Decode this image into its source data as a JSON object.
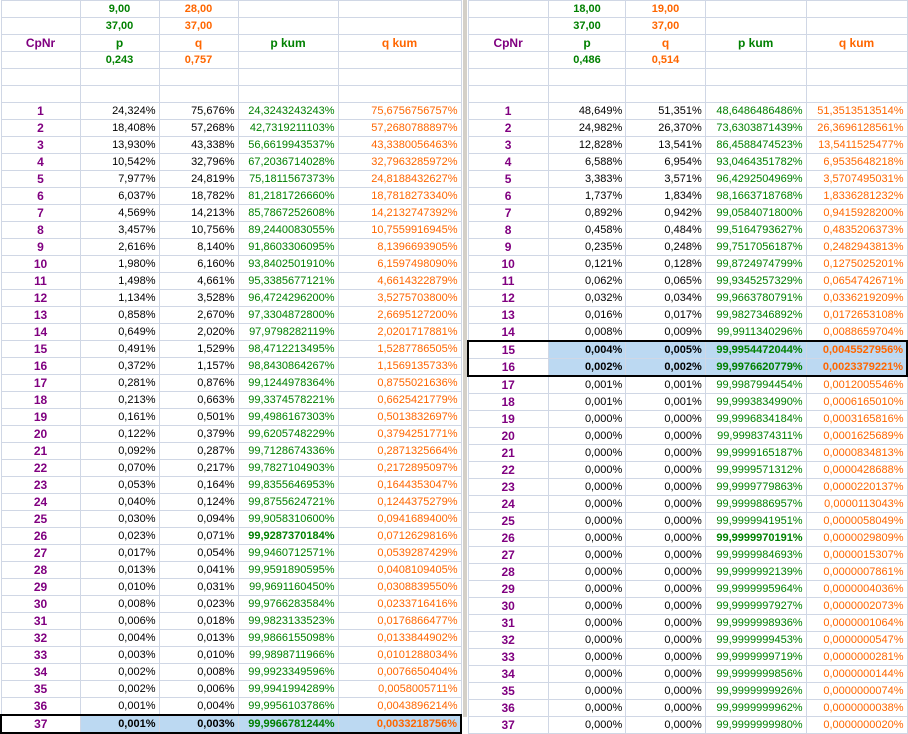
{
  "left": {
    "top1": {
      "p": "9,00",
      "q": "28,00"
    },
    "top2": {
      "p": "37,00",
      "q": "37,00"
    },
    "headers": {
      "nr": "CpNr",
      "p": "p",
      "q": "q",
      "pk": "p kum",
      "qk": "q kum"
    },
    "probs": {
      "p": "0,243",
      "q": "0,757"
    },
    "rows": [
      [
        "1",
        "24,324%",
        "75,676%",
        "24,3243243243%",
        "75,6756756757%"
      ],
      [
        "2",
        "18,408%",
        "57,268%",
        "42,7319211103%",
        "57,2680788897%"
      ],
      [
        "3",
        "13,930%",
        "43,338%",
        "56,6619943537%",
        "43,3380056463%"
      ],
      [
        "4",
        "10,542%",
        "32,796%",
        "67,2036714028%",
        "32,7963285972%"
      ],
      [
        "5",
        "7,977%",
        "24,819%",
        "75,1811567373%",
        "24,8188432627%"
      ],
      [
        "6",
        "6,037%",
        "18,782%",
        "81,2181726660%",
        "18,7818273340%"
      ],
      [
        "7",
        "4,569%",
        "14,213%",
        "85,7867252608%",
        "14,2132747392%"
      ],
      [
        "8",
        "3,457%",
        "10,756%",
        "89,2440083055%",
        "10,7559916945%"
      ],
      [
        "9",
        "2,616%",
        "8,140%",
        "91,8603306095%",
        "8,1396693905%"
      ],
      [
        "10",
        "1,980%",
        "6,160%",
        "93,8402501910%",
        "6,1597498090%"
      ],
      [
        "11",
        "1,498%",
        "4,661%",
        "95,3385677121%",
        "4,6614322879%"
      ],
      [
        "12",
        "1,134%",
        "3,528%",
        "96,4724296200%",
        "3,5275703800%"
      ],
      [
        "13",
        "0,858%",
        "2,670%",
        "97,3304872800%",
        "2,6695127200%"
      ],
      [
        "14",
        "0,649%",
        "2,020%",
        "97,9798282119%",
        "2,0201717881%"
      ],
      [
        "15",
        "0,491%",
        "1,529%",
        "98,4712213495%",
        "1,5287786505%"
      ],
      [
        "16",
        "0,372%",
        "1,157%",
        "98,8430864267%",
        "1,1569135733%"
      ],
      [
        "17",
        "0,281%",
        "0,876%",
        "99,1244978364%",
        "0,8755021636%"
      ],
      [
        "18",
        "0,213%",
        "0,663%",
        "99,3374578221%",
        "0,6625421779%"
      ],
      [
        "19",
        "0,161%",
        "0,501%",
        "99,4986167303%",
        "0,5013832697%"
      ],
      [
        "20",
        "0,122%",
        "0,379%",
        "99,6205748229%",
        "0,3794251771%"
      ],
      [
        "21",
        "0,092%",
        "0,287%",
        "99,7128674336%",
        "0,2871325664%"
      ],
      [
        "22",
        "0,070%",
        "0,217%",
        "99,7827104903%",
        "0,2172895097%"
      ],
      [
        "23",
        "0,053%",
        "0,164%",
        "99,8355646953%",
        "0,1644353047%"
      ],
      [
        "24",
        "0,040%",
        "0,124%",
        "99,8755624721%",
        "0,1244375279%"
      ],
      [
        "25",
        "0,030%",
        "0,094%",
        "99,9058310600%",
        "0,0941689400%"
      ],
      [
        "26",
        "0,023%",
        "0,071%",
        "99,9287370184%",
        "0,0712629816%"
      ],
      [
        "27",
        "0,017%",
        "0,054%",
        "99,9460712571%",
        "0,0539287429%"
      ],
      [
        "28",
        "0,013%",
        "0,041%",
        "99,9591890595%",
        "0,0408109405%"
      ],
      [
        "29",
        "0,010%",
        "0,031%",
        "99,9691160450%",
        "0,0308839550%"
      ],
      [
        "30",
        "0,008%",
        "0,023%",
        "99,9766283584%",
        "0,0233716416%"
      ],
      [
        "31",
        "0,006%",
        "0,018%",
        "99,9823133523%",
        "0,0176866477%"
      ],
      [
        "32",
        "0,004%",
        "0,013%",
        "99,9866155098%",
        "0,0133844902%"
      ],
      [
        "33",
        "0,003%",
        "0,010%",
        "99,9898711966%",
        "0,0101288034%"
      ],
      [
        "34",
        "0,002%",
        "0,008%",
        "99,9923349596%",
        "0,0076650404%"
      ],
      [
        "35",
        "0,002%",
        "0,006%",
        "99,9941994289%",
        "0,0058005711%"
      ],
      [
        "36",
        "0,001%",
        "0,004%",
        "99,9956103786%",
        "0,0043896214%"
      ],
      [
        "37",
        "0,001%",
        "0,003%",
        "99,9966781244%",
        "0,0033218756%"
      ]
    ]
  },
  "right": {
    "top1": {
      "p": "18,00",
      "q": "19,00"
    },
    "top2": {
      "p": "37,00",
      "q": "37,00"
    },
    "headers": {
      "nr": "CpNr",
      "p": "p",
      "q": "q",
      "pk": "p kum",
      "qk": "q kum"
    },
    "probs": {
      "p": "0,486",
      "q": "0,514"
    },
    "rows": [
      [
        "1",
        "48,649%",
        "51,351%",
        "48,6486486486%",
        "51,3513513514%"
      ],
      [
        "2",
        "24,982%",
        "26,370%",
        "73,6303871439%",
        "26,3696128561%"
      ],
      [
        "3",
        "12,828%",
        "13,541%",
        "86,4588474523%",
        "13,5411525477%"
      ],
      [
        "4",
        "6,588%",
        "6,954%",
        "93,0464351782%",
        "6,9535648218%"
      ],
      [
        "5",
        "3,383%",
        "3,571%",
        "96,4292504969%",
        "3,5707495031%"
      ],
      [
        "6",
        "1,737%",
        "1,834%",
        "98,1663718768%",
        "1,8336281232%"
      ],
      [
        "7",
        "0,892%",
        "0,942%",
        "99,0584071800%",
        "0,9415928200%"
      ],
      [
        "8",
        "0,458%",
        "0,484%",
        "99,5164793627%",
        "0,4835206373%"
      ],
      [
        "9",
        "0,235%",
        "0,248%",
        "99,7517056187%",
        "0,2482943813%"
      ],
      [
        "10",
        "0,121%",
        "0,128%",
        "99,8724974799%",
        "0,1275025201%"
      ],
      [
        "11",
        "0,062%",
        "0,065%",
        "99,9345257329%",
        "0,0654742671%"
      ],
      [
        "12",
        "0,032%",
        "0,034%",
        "99,9663780791%",
        "0,0336219209%"
      ],
      [
        "13",
        "0,016%",
        "0,017%",
        "99,9827346892%",
        "0,0172653108%"
      ],
      [
        "14",
        "0,008%",
        "0,009%",
        "99,9911340296%",
        "0,0088659704%"
      ],
      [
        "15",
        "0,004%",
        "0,005%",
        "99,9954472044%",
        "0,0045527956%"
      ],
      [
        "16",
        "0,002%",
        "0,002%",
        "99,9976620779%",
        "0,0023379221%"
      ],
      [
        "17",
        "0,001%",
        "0,001%",
        "99,9987994454%",
        "0,0012005546%"
      ],
      [
        "18",
        "0,001%",
        "0,001%",
        "99,9993834990%",
        "0,0006165010%"
      ],
      [
        "19",
        "0,000%",
        "0,000%",
        "99,9996834184%",
        "0,0003165816%"
      ],
      [
        "20",
        "0,000%",
        "0,000%",
        "99,9998374311%",
        "0,0001625689%"
      ],
      [
        "21",
        "0,000%",
        "0,000%",
        "99,9999165187%",
        "0,0000834813%"
      ],
      [
        "22",
        "0,000%",
        "0,000%",
        "99,9999571312%",
        "0,0000428688%"
      ],
      [
        "23",
        "0,000%",
        "0,000%",
        "99,9999779863%",
        "0,0000220137%"
      ],
      [
        "24",
        "0,000%",
        "0,000%",
        "99,9999886957%",
        "0,0000113043%"
      ],
      [
        "25",
        "0,000%",
        "0,000%",
        "99,9999941951%",
        "0,0000058049%"
      ],
      [
        "26",
        "0,000%",
        "0,000%",
        "99,9999970191%",
        "0,0000029809%"
      ],
      [
        "27",
        "0,000%",
        "0,000%",
        "99,9999984693%",
        "0,0000015307%"
      ],
      [
        "28",
        "0,000%",
        "0,000%",
        "99,9999992139%",
        "0,0000007861%"
      ],
      [
        "29",
        "0,000%",
        "0,000%",
        "99,9999995964%",
        "0,0000004036%"
      ],
      [
        "30",
        "0,000%",
        "0,000%",
        "99,9999997927%",
        "0,0000002073%"
      ],
      [
        "31",
        "0,000%",
        "0,000%",
        "99,9999998936%",
        "0,0000001064%"
      ],
      [
        "32",
        "0,000%",
        "0,000%",
        "99,9999999453%",
        "0,0000000547%"
      ],
      [
        "33",
        "0,000%",
        "0,000%",
        "99,9999999719%",
        "0,0000000281%"
      ],
      [
        "34",
        "0,000%",
        "0,000%",
        "99,9999999856%",
        "0,0000000144%"
      ],
      [
        "35",
        "0,000%",
        "0,000%",
        "99,9999999926%",
        "0,0000000074%"
      ],
      [
        "36",
        "0,000%",
        "0,000%",
        "99,9999999962%",
        "0,0000000038%"
      ],
      [
        "37",
        "0,000%",
        "0,000%",
        "99,9999999980%",
        "0,0000000020%"
      ]
    ]
  }
}
